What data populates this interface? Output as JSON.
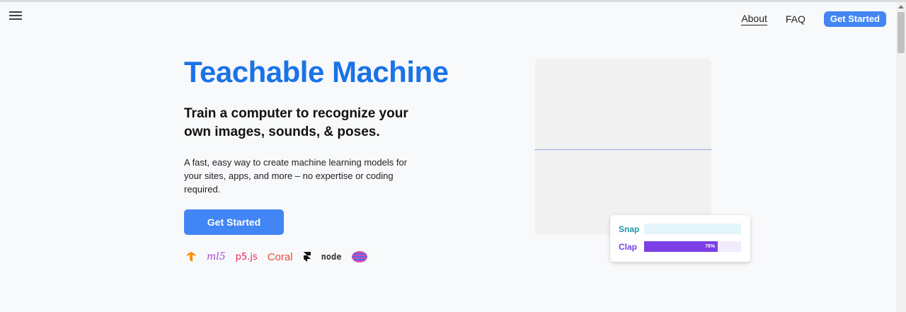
{
  "nav": {
    "menu_icon": "hamburger-menu-icon",
    "links": [
      {
        "label": "About"
      },
      {
        "label": "FAQ"
      }
    ],
    "cta_label": "Get Started"
  },
  "hero": {
    "title": "Teachable Machine",
    "subtitle": "Train a computer to recognize your own images, sounds, & poses.",
    "description": "A fast, easy way to create machine learning models for your sites, apps, and more – no expertise or coding required.",
    "cta_label": "Get Started"
  },
  "logos": [
    {
      "name": "tensorflow-logo-icon"
    },
    {
      "text": "ml5"
    },
    {
      "text": "p5.js"
    },
    {
      "text": "Coral"
    },
    {
      "name": "framer-logo-icon"
    },
    {
      "text": "node"
    },
    {
      "name": "glitch-logo-icon"
    }
  ],
  "demo": {
    "classes": [
      {
        "label": "Snap",
        "color": "#2196a8",
        "track_color": "#e3f4fa",
        "value": 0,
        "value_label": ""
      },
      {
        "label": "Clap",
        "color": "#7b3fe4",
        "track_color": "#f1ebfb",
        "value": 0.76,
        "value_label": "76%"
      }
    ]
  },
  "colors": {
    "accent": "#4285f4",
    "title": "#1a73e8"
  }
}
